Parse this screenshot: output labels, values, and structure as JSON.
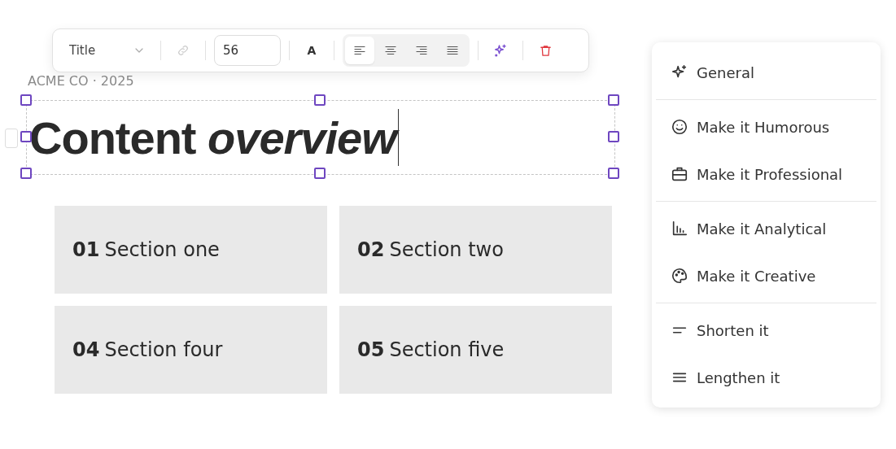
{
  "slide": {
    "kicker": "ACME CO · 2025",
    "title": "Content *overview*",
    "sections": [
      {
        "number": "01",
        "label": "Section one"
      },
      {
        "number": "02",
        "label": "Section two"
      },
      {
        "number": "04",
        "label": "Section four"
      },
      {
        "number": "05",
        "label": "Section five"
      }
    ]
  },
  "toolbar": {
    "style": "Title",
    "font_size": "56",
    "font_letter": "A",
    "align": [
      {
        "kind": "left",
        "selected": true
      },
      {
        "kind": "center",
        "selected": false
      },
      {
        "kind": "right",
        "selected": false
      },
      {
        "kind": "justify",
        "selected": false
      }
    ]
  },
  "ai_menu": {
    "groups": [
      [
        {
          "kind": "sparkle",
          "label": "General"
        }
      ],
      [
        {
          "kind": "smile",
          "label": "Make it Humorous"
        },
        {
          "kind": "briefcase",
          "label": "Make it Professional"
        }
      ],
      [
        {
          "kind": "chart",
          "label": "Make it Analytical"
        },
        {
          "kind": "palette",
          "label": "Make it Creative"
        }
      ],
      [
        {
          "kind": "short",
          "label": "Shorten it"
        },
        {
          "kind": "long",
          "label": "Lengthen it"
        }
      ]
    ]
  }
}
